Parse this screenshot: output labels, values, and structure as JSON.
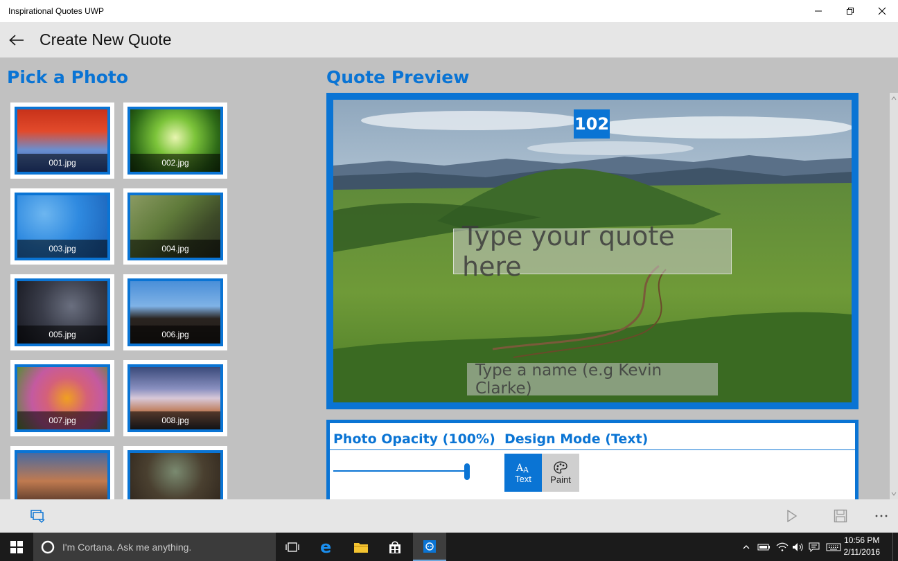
{
  "window": {
    "title": "Inspirational Quotes UWP"
  },
  "header": {
    "title": "Create New Quote"
  },
  "pick": {
    "title": "Pick a Photo",
    "photos": [
      "001.jpg",
      "002.jpg",
      "003.jpg",
      "004.jpg",
      "005.jpg",
      "006.jpg",
      "007.jpg",
      "008.jpg",
      "",
      ""
    ]
  },
  "preview": {
    "title": "Quote Preview",
    "badge": "102",
    "quote_placeholder": "Type your quote here",
    "name_placeholder": "Type a name (e.g Kevin Clarke)"
  },
  "controls": {
    "opacity_label": "Photo Opacity (100%)",
    "opacity_value": 1.0,
    "design_label": "Design Mode (Text)",
    "modes": [
      {
        "label": "Text",
        "active": true
      },
      {
        "label": "Paint",
        "active": false
      }
    ]
  },
  "taskbar": {
    "cortana_placeholder": "I'm Cortana. Ask me anything.",
    "time": "10:56 PM",
    "date": "2/11/2016"
  },
  "colors": {
    "accent": "#0a74d4"
  }
}
